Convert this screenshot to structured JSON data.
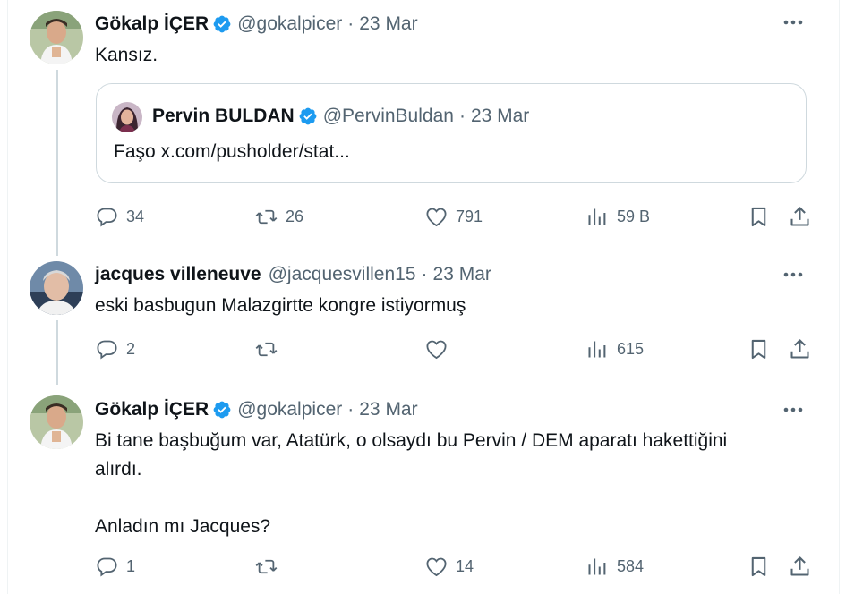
{
  "colors": {
    "text": "#0f1419",
    "secondary": "#536471",
    "verified": "#1d9bf0",
    "border": "#cfd9de"
  },
  "tweets": [
    {
      "name": "Gökalp İÇER",
      "verified": true,
      "handle": "@gokalpicer",
      "separator": "·",
      "date": "23 Mar",
      "text": "Kansız.",
      "quote": {
        "name": "Pervin BULDAN",
        "verified": true,
        "handle": "@PervinBuldan",
        "separator": "·",
        "date": "23 Mar",
        "text": "Faşo x.com/pusholder/stat..."
      },
      "stats": {
        "replies": "34",
        "retweets": "26",
        "likes": "791",
        "views": "59 B"
      }
    },
    {
      "name": "jacques villeneuve",
      "verified": false,
      "handle": "@jacquesvillen15",
      "separator": "·",
      "date": "23 Mar",
      "text": "eski basbugun Malazgirtte kongre istiyormuş",
      "stats": {
        "replies": "2",
        "retweets": "",
        "likes": "",
        "views": "615"
      }
    },
    {
      "name": "Gökalp İÇER",
      "verified": true,
      "handle": "@gokalpicer",
      "separator": "·",
      "date": "23 Mar",
      "text_lines": [
        "Bi tane başbuğum var, Atatürk, o olsaydı bu Pervin / DEM aparatı hakettiğini",
        "alırdı.",
        "",
        "Anladın mı Jacques?"
      ],
      "stats": {
        "replies": "1",
        "retweets": "",
        "likes": "14",
        "views": "584"
      }
    }
  ],
  "icons": [
    "more-icon",
    "verified-badge-icon",
    "reply-icon",
    "retweet-icon",
    "like-icon",
    "views-icon",
    "bookmark-icon",
    "share-icon"
  ]
}
